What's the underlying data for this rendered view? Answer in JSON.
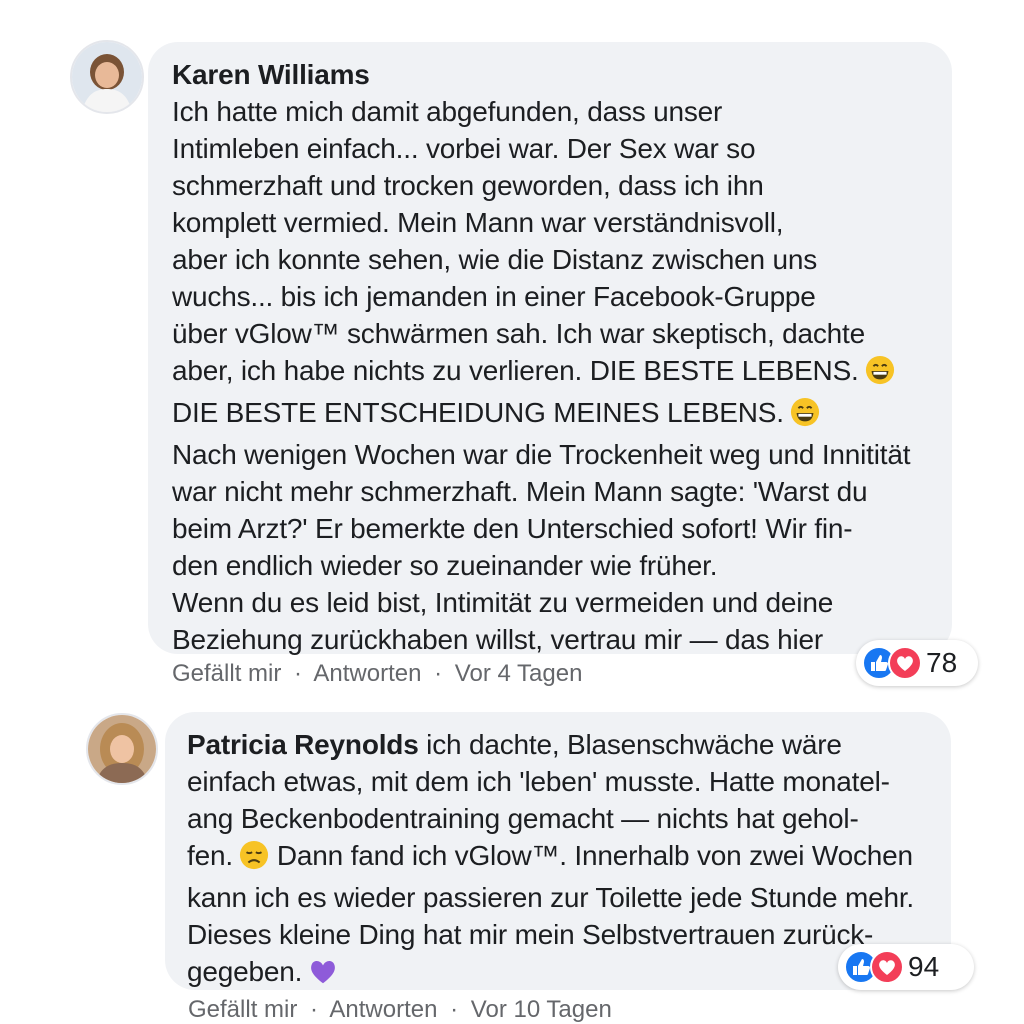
{
  "comments": [
    {
      "author": "Karen Williams",
      "lines": [
        "Ich hatte mich damit abgefunden, dass unser",
        "Intimleben einfach... vorbei war. Der Sex war so",
        "schmerzhaft und trocken geworden, dass ich ihn",
        "komplett vermied. Mein Mann war verständnisvoll,",
        "aber ich konnte sehen, wie die Distanz zwischen uns",
        "wuchs... bis ich jemanden in einer Facebook-Gruppe",
        "über vGlow™ schwärmen sah. Ich war skeptisch, dachte",
        "aber, ich habe nichts zu verlieren. DIE BESTE LEBENS.",
        "DIE BESTE ENTSCHEIDUNG MEINES LEBENS.",
        "Nach wenigen Wochen war die Trockenheit weg und Innitität",
        "war nicht mehr schmerzhaft. Mein Mann sagte: 'Warst du",
        "beim Arzt?' Er bemerkte den Unterschied sofort! Wir fin-",
        "den endlich wieder so zueinander wie früher.",
        "Wenn du es leid bist, Intimität zu vermeiden und deine",
        "Beziehung zurückhaben willst, vertrau mir — das hier"
      ],
      "emoji_lines": [
        7,
        8
      ],
      "emoji_icon": "grinning-face-icon",
      "like_label": "Gefällt mir",
      "reply_label": "Antworten",
      "time": "Vor 4 Tagen",
      "separator": "·",
      "reaction_count": "78",
      "reaction_icons": [
        "like-icon",
        "love-icon"
      ]
    },
    {
      "author": "Patricia Reynolds",
      "first_line_text": " ich dachte, Blasenschwäche wäre",
      "lines": [
        "einfach etwas, mit dem ich 'leben' musste. Hatte monatel-",
        "ang Beckenbodentraining gemacht — nichts hat gehol-",
        "fen.",
        "Dann fand ich vGlow™. Innerhalb von zwei Wochen",
        "kann ich es wieder passieren zur Toilette jede Stunde mehr.",
        "Dieses kleine Ding hat mir mein Selbstvertrauen zurück-",
        "gegeben."
      ],
      "emoji_icons": [
        "disappointed-face-icon",
        "purple-heart-icon"
      ],
      "like_label": "Gefällt mir",
      "reply_label": "Antworten",
      "time": "Vor 10 Tagen",
      "separator": "·",
      "reaction_count": "94",
      "reaction_icons": [
        "like-icon",
        "love-icon"
      ]
    }
  ],
  "colors": {
    "bubble": "#f0f2f5",
    "meta_text": "#65676b",
    "like_blue": "#1877f2",
    "love_red": "#f33e58",
    "purple_heart": "#8e5bd9",
    "emoji_yellow": "#f7c325"
  }
}
